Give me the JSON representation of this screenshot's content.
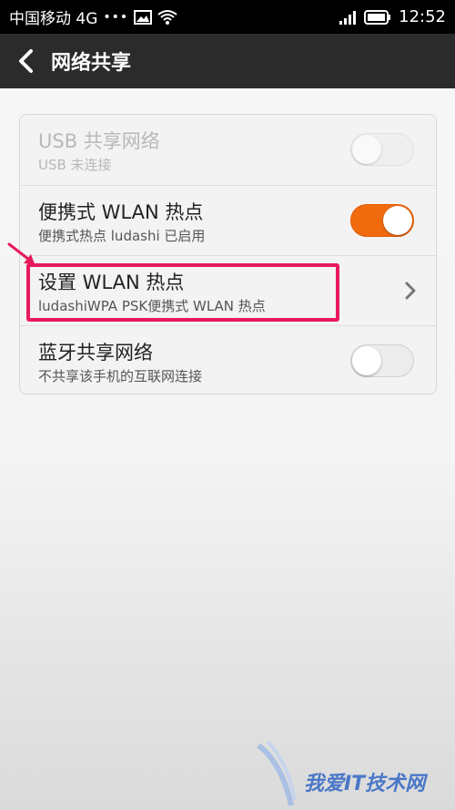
{
  "status_bar": {
    "carrier": "中国移动 4G",
    "dots": "•••",
    "time": "12:52",
    "icons": [
      "image-icon",
      "wifi-icon",
      "signal-icon",
      "battery-icon"
    ]
  },
  "header": {
    "title": "网络共享",
    "back_icon": "chevron-left-icon"
  },
  "settings": {
    "items": [
      {
        "title": "USB 共享网络",
        "subtitle": "USB 未连接",
        "control": "toggle",
        "on": false,
        "enabled": false
      },
      {
        "title": "便携式 WLAN 热点",
        "subtitle": "便携式热点 ludashi 已启用",
        "control": "toggle",
        "on": true,
        "enabled": true
      },
      {
        "title": "设置 WLAN 热点",
        "subtitle": "ludashiWPA PSK便携式 WLAN 热点",
        "control": "chevron",
        "enabled": true
      },
      {
        "title": "蓝牙共享网络",
        "subtitle": "不共享该手机的互联网连接",
        "control": "toggle",
        "on": false,
        "enabled": true
      }
    ]
  },
  "annotation": {
    "color": "#e8195c"
  },
  "watermark": {
    "text": "我爱IT技术网"
  },
  "colors": {
    "accent": "#f06a0e",
    "header_bg": "#2b2b2b"
  }
}
